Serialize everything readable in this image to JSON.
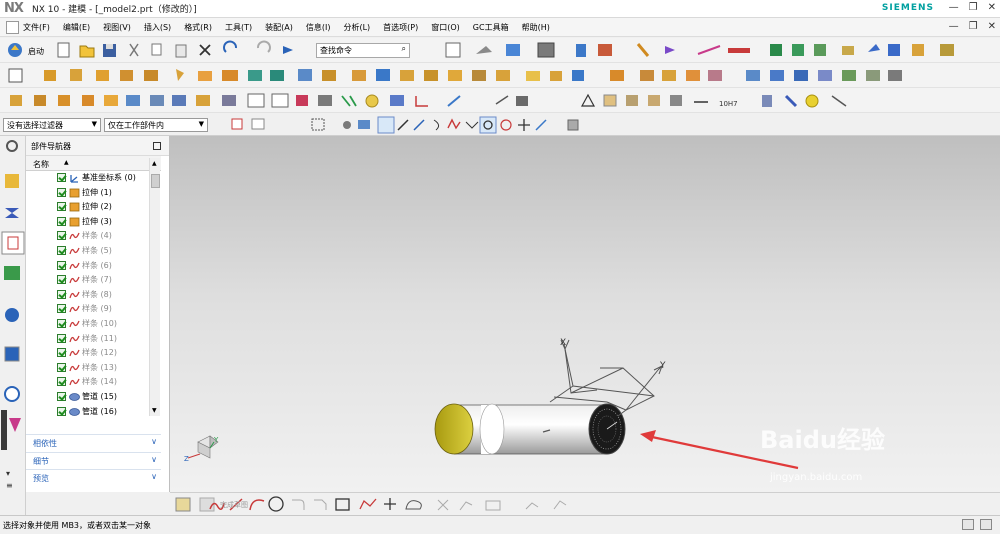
{
  "window": {
    "logo": "NX",
    "title": "NX 10 - 建模 - [_model2.prt（修改的）]",
    "brand": "SIEMENS"
  },
  "menubar": {
    "items": [
      "文件(F)",
      "编辑(E)",
      "视图(V)",
      "插入(S)",
      "格式(R)",
      "工具(T)",
      "装配(A)",
      "信息(I)",
      "分析(L)",
      "首选项(P)",
      "窗口(O)",
      "GC工具箱",
      "帮助(H)"
    ]
  },
  "toolbar": {
    "start_label": "启动",
    "command_finder_placeholder": "查找命令"
  },
  "selection_bar": {
    "filter_value": "没有选择过滤器",
    "scope_value": "仅在工作部件内"
  },
  "navigator": {
    "title": "部件导航器",
    "column_name": "名称",
    "items": [
      {
        "label": "基准坐标系 (0)",
        "type": "csys",
        "dim": false
      },
      {
        "label": "拉伸 (1)",
        "type": "extrude",
        "dim": false
      },
      {
        "label": "拉伸 (2)",
        "type": "extrude",
        "dim": false
      },
      {
        "label": "拉伸 (3)",
        "type": "extrude",
        "dim": false
      },
      {
        "label": "样条 (4)",
        "type": "spline",
        "dim": true
      },
      {
        "label": "样条 (5)",
        "type": "spline",
        "dim": true
      },
      {
        "label": "样条 (6)",
        "type": "spline",
        "dim": true
      },
      {
        "label": "样条 (7)",
        "type": "spline",
        "dim": true
      },
      {
        "label": "样条 (8)",
        "type": "spline",
        "dim": true
      },
      {
        "label": "样条 (9)",
        "type": "spline",
        "dim": true
      },
      {
        "label": "样条 (10)",
        "type": "spline",
        "dim": true
      },
      {
        "label": "样条 (11)",
        "type": "spline",
        "dim": true
      },
      {
        "label": "样条 (12)",
        "type": "spline",
        "dim": true
      },
      {
        "label": "样条 (13)",
        "type": "spline",
        "dim": true
      },
      {
        "label": "样条 (14)",
        "type": "spline",
        "dim": true
      },
      {
        "label": "管道 (15)",
        "type": "tube",
        "dim": false
      },
      {
        "label": "管道 (16)",
        "type": "tube",
        "dim": false
      }
    ],
    "panels": [
      "相依性",
      "细节",
      "预览"
    ]
  },
  "sketch_bar": {
    "finish_label": "完成草图"
  },
  "viewport": {
    "axis_labels": {
      "x": "X",
      "y": "Y"
    },
    "triad_labels": {
      "x": "X",
      "y": "Y",
      "z": "Z"
    }
  },
  "status": {
    "message": "选择对象并使用 MB3，或者双击某一对象"
  },
  "watermark": {
    "brand": "Baidu经验",
    "url": "jingyan.baidu.com"
  },
  "colors": {
    "accent": "#00a0a0",
    "link_blue": "#2a63b8",
    "annotation_arrow": "#e03a3a",
    "cylinder_cap": "#c9c200"
  }
}
